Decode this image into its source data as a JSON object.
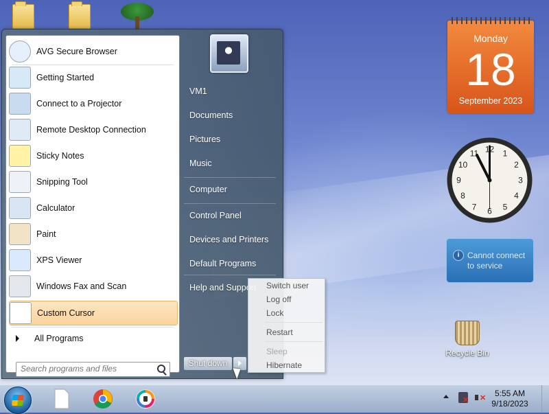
{
  "start_menu": {
    "programs": [
      {
        "label": "AVG Secure Browser",
        "icon": "avg-browser-icon"
      },
      {
        "label": "Getting Started",
        "icon": "getting-started-icon"
      },
      {
        "label": "Connect to a Projector",
        "icon": "projector-icon"
      },
      {
        "label": "Remote Desktop Connection",
        "icon": "remote-desktop-icon"
      },
      {
        "label": "Sticky Notes",
        "icon": "sticky-notes-icon"
      },
      {
        "label": "Snipping Tool",
        "icon": "scissors-icon"
      },
      {
        "label": "Calculator",
        "icon": "calculator-icon"
      },
      {
        "label": "Paint",
        "icon": "paint-palette-icon"
      },
      {
        "label": "XPS Viewer",
        "icon": "xps-viewer-icon"
      },
      {
        "label": "Windows Fax and Scan",
        "icon": "fax-icon"
      },
      {
        "label": "Custom Cursor",
        "icon": "cursor-arrow-icon"
      }
    ],
    "all_programs": "All Programs",
    "search_placeholder": "Search programs and files",
    "right_items": [
      "VM1",
      "Documents",
      "Pictures",
      "Music",
      "Computer",
      "Control Panel",
      "Devices and Printers",
      "Default Programs",
      "Help and Support"
    ],
    "shutdown_label": "Shut down",
    "submenu": {
      "items": [
        "Switch user",
        "Log off",
        "Lock",
        "Restart",
        "Sleep",
        "Hibernate"
      ]
    }
  },
  "gadgets": {
    "calendar": {
      "day_name": "Monday",
      "day_number": "18",
      "month_year": "September 2023"
    },
    "service_message": "Cannot connect to service",
    "clock_numbers": [
      "12",
      "1",
      "2",
      "3",
      "4",
      "5",
      "6",
      "7",
      "8",
      "9",
      "10",
      "11"
    ]
  },
  "desktop": {
    "recycle_bin_label": "Recycle Bin"
  },
  "taskbar": {
    "time": "5:55 AM",
    "date": "9/18/2023"
  },
  "colors": {
    "highlight": "#fbd39a",
    "calendar": "#e86a28",
    "service_gadget": "#2a6fb5"
  }
}
